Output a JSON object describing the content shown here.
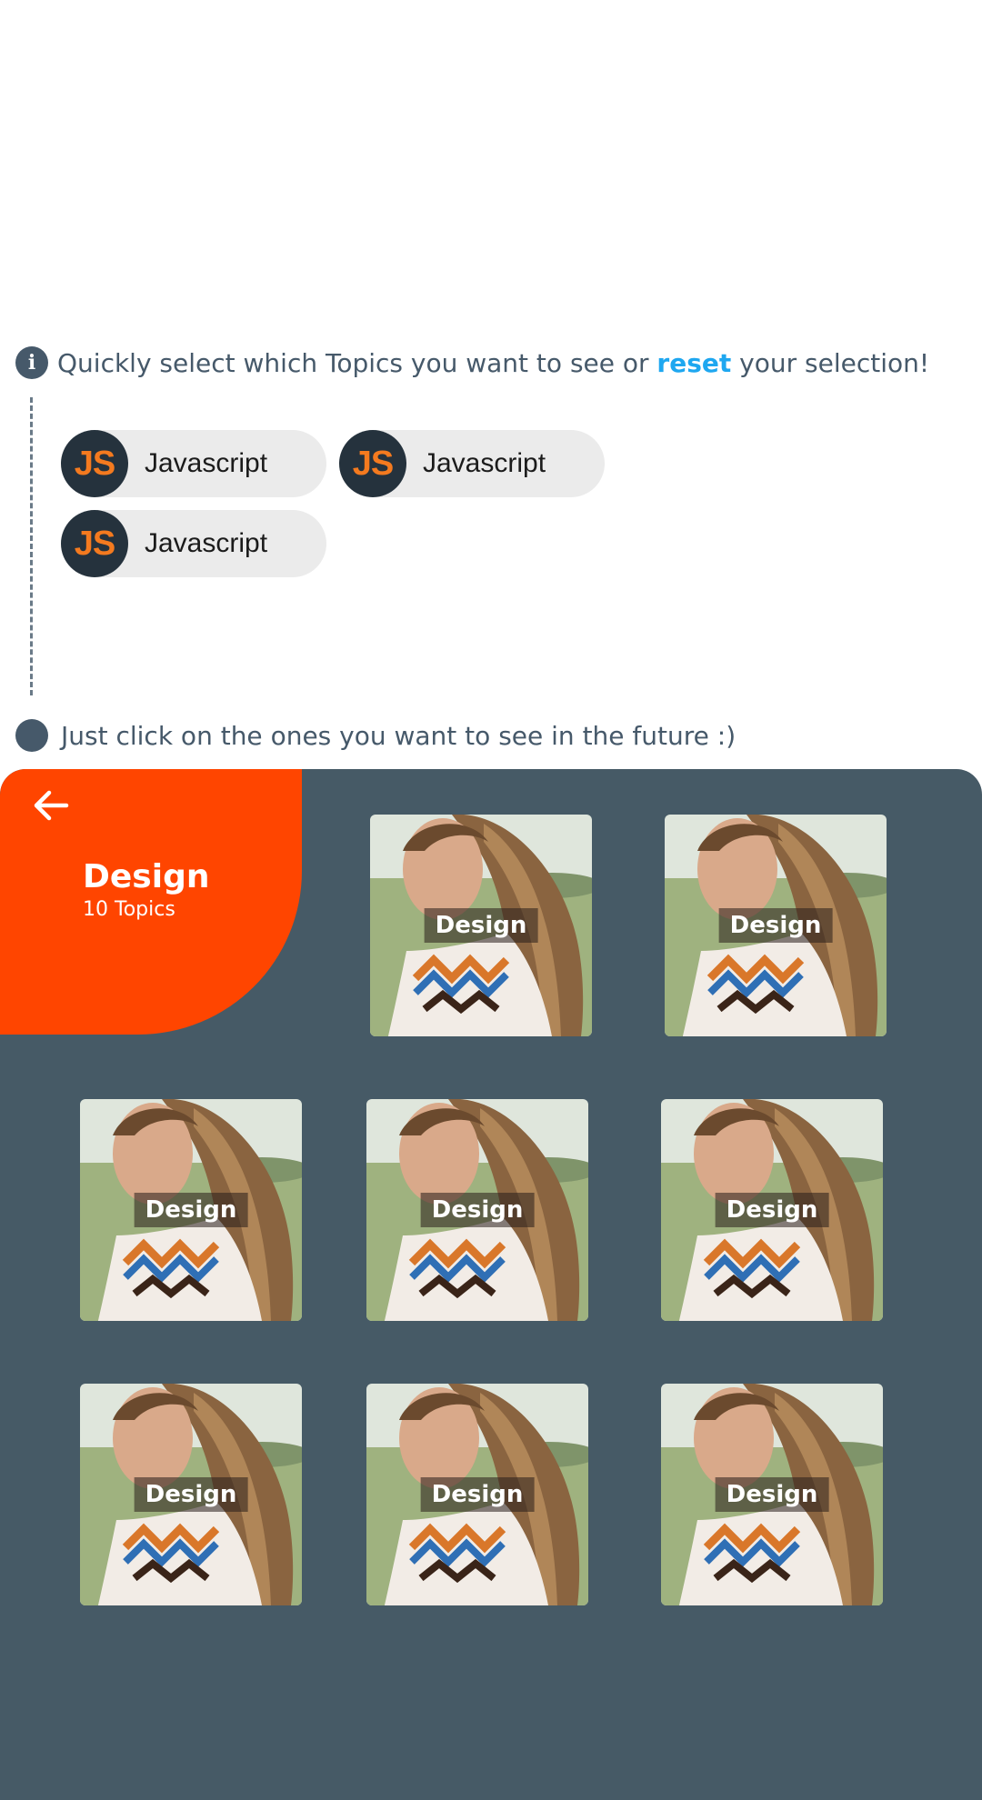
{
  "info": {
    "icon": "info-icon",
    "text_before": "Quickly select which Topics you want to see or ",
    "reset_label": "reset",
    "text_after": " your selection!"
  },
  "chips": [
    {
      "logo": "JS",
      "label": "Javascript"
    },
    {
      "logo": "JS",
      "label": "Javascript"
    },
    {
      "logo": "JS",
      "label": "Javascript"
    }
  ],
  "hint": {
    "text": "Just click on the ones you want to see in the future :)"
  },
  "category": {
    "title": "Design",
    "subtitle": "10 Topics",
    "accent": "#ff4500",
    "panel_color": "#465a66",
    "back_icon": "arrow-left-icon"
  },
  "tiles": [
    {
      "label": "Design"
    },
    {
      "label": "Design"
    },
    {
      "label": "Design"
    },
    {
      "label": "Design"
    },
    {
      "label": "Design"
    },
    {
      "label": "Design"
    },
    {
      "label": "Design"
    },
    {
      "label": "Design"
    }
  ]
}
